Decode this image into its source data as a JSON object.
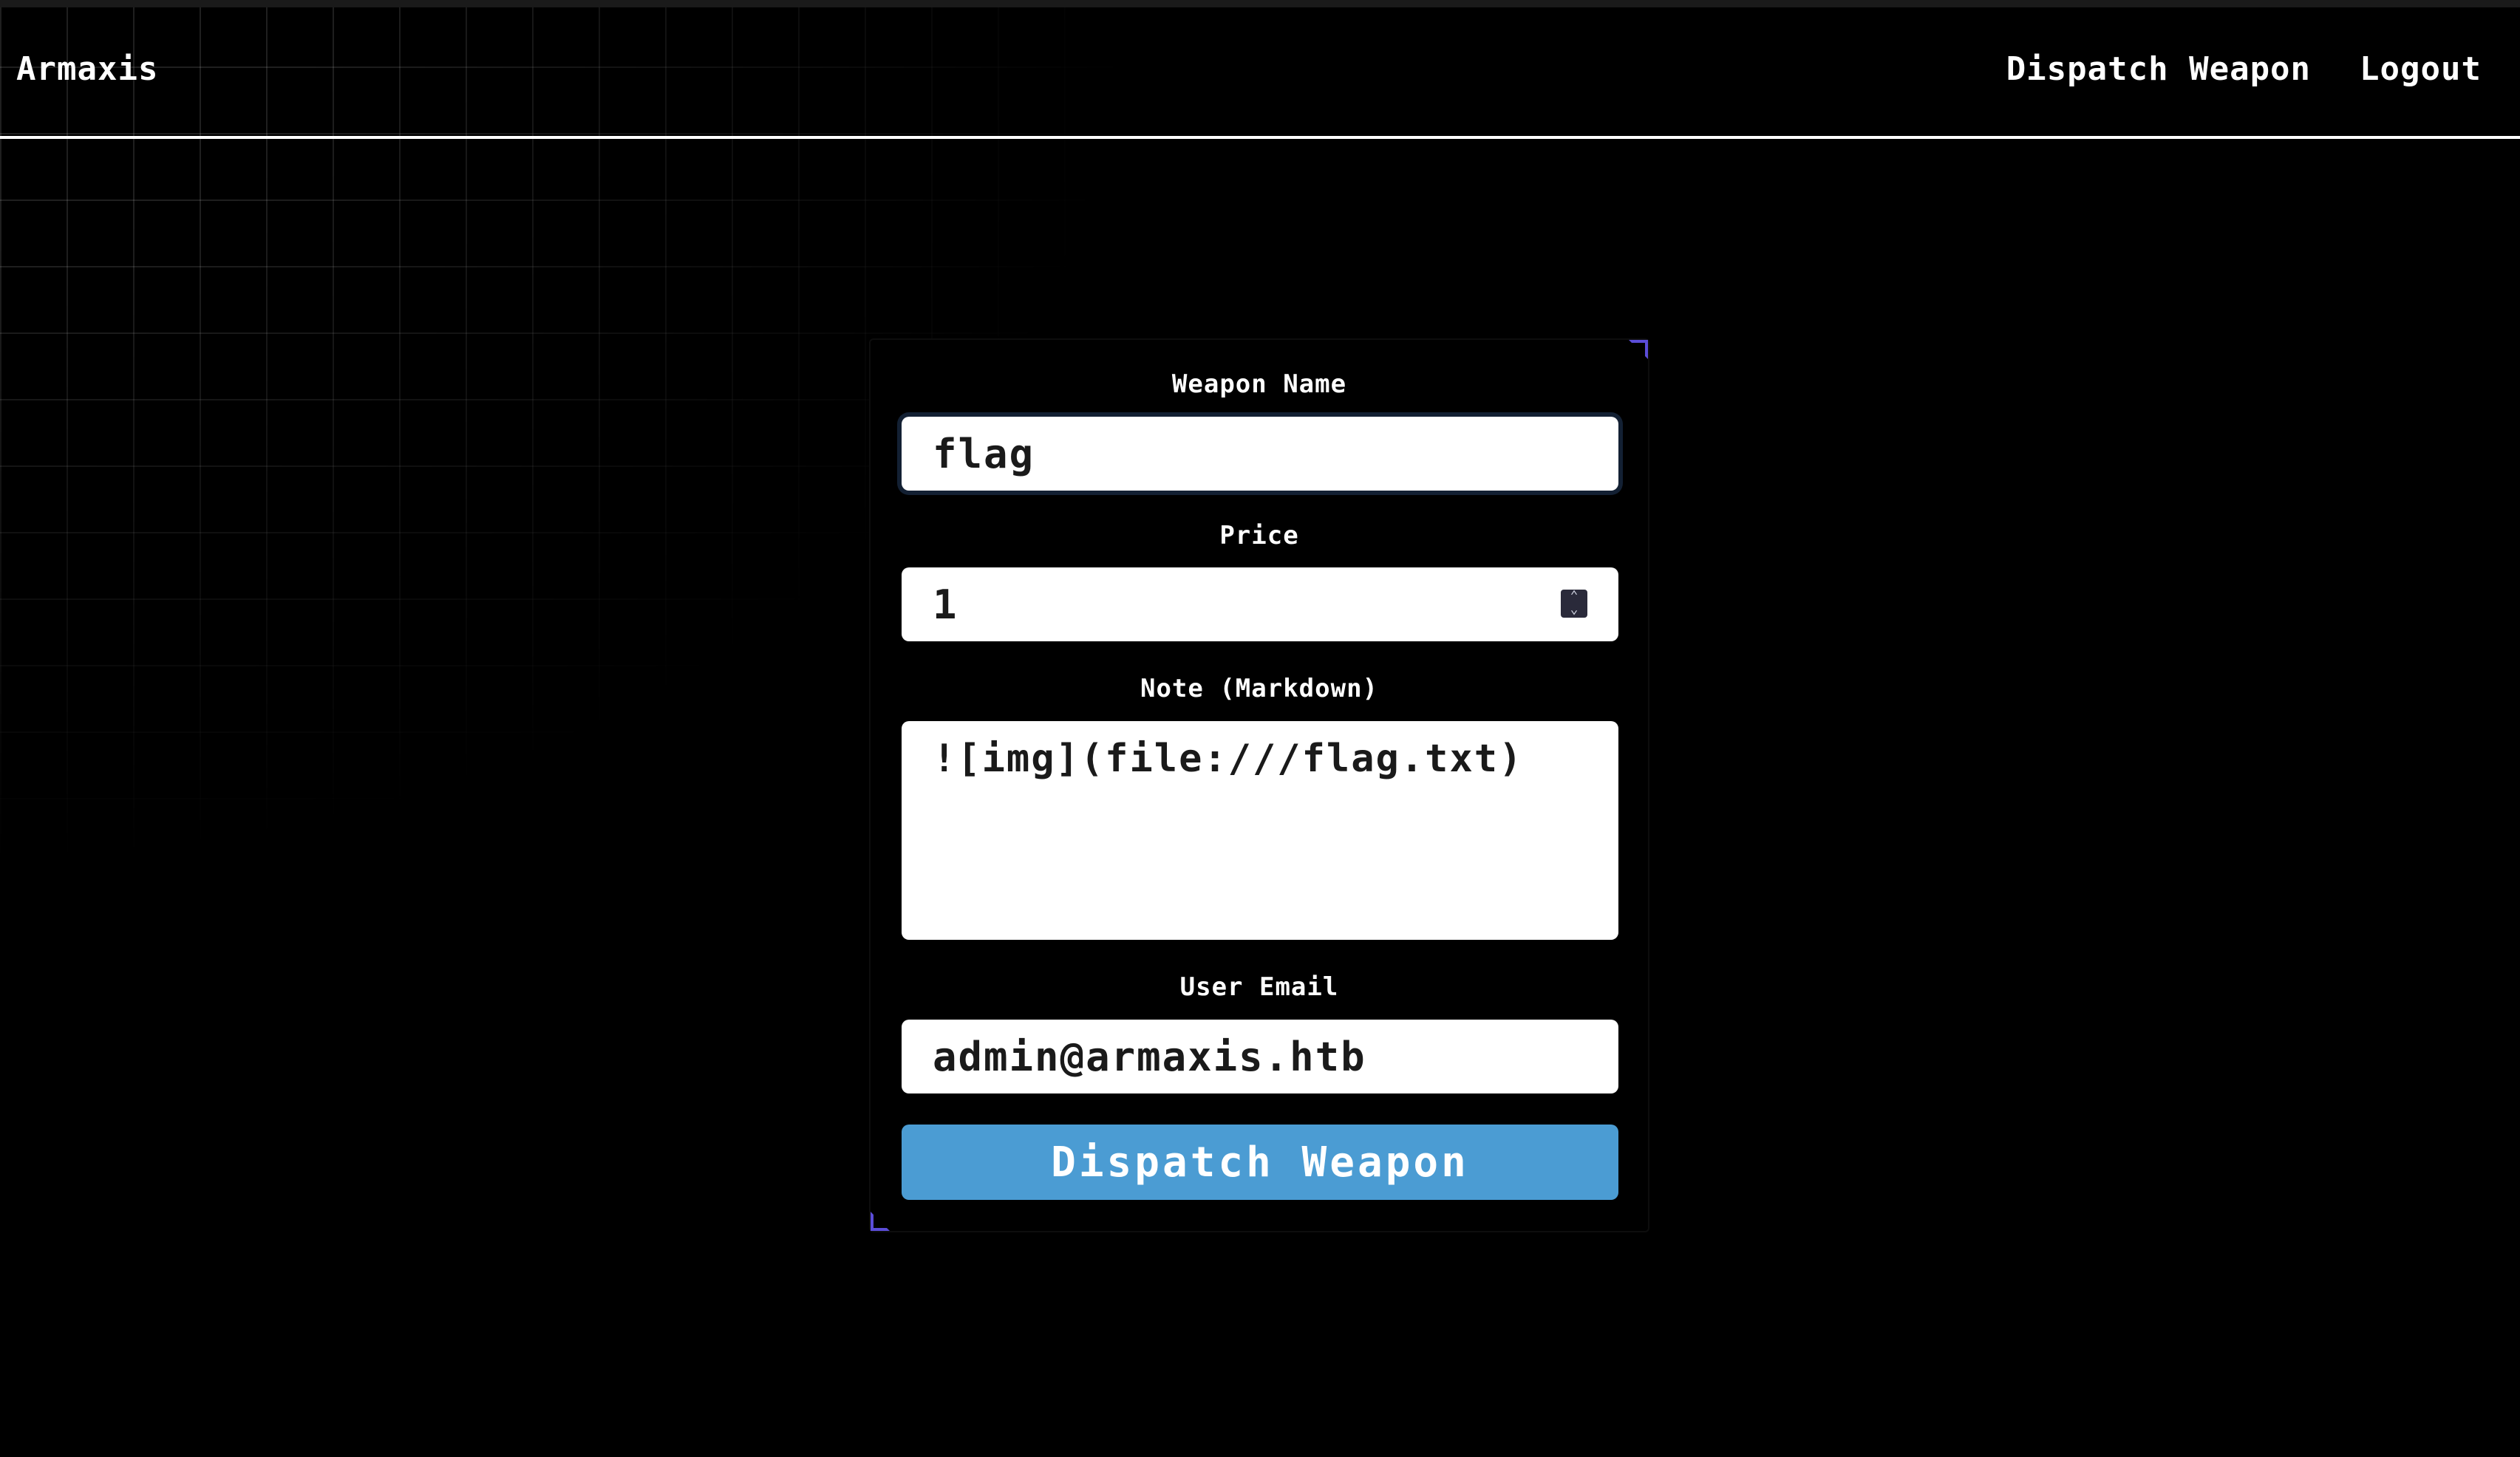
{
  "navbar": {
    "brand": "Armaxis",
    "links": [
      {
        "label": "Dispatch Weapon"
      },
      {
        "label": "Logout"
      }
    ]
  },
  "form": {
    "weapon_name": {
      "label": "Weapon Name",
      "value": "flag"
    },
    "price": {
      "label": "Price",
      "value": "1"
    },
    "note": {
      "label": "Note (Markdown)",
      "value": "![img](file:///flag.txt)"
    },
    "user_email": {
      "label": "User Email",
      "value": "admin@armaxis.htb"
    },
    "submit_label": "Dispatch Weapon"
  },
  "icons": {
    "spinner": "up-down-arrows-icon"
  },
  "colors": {
    "background": "#000000",
    "button": "#4b9cd3",
    "accent_corner": "#5b4dd8"
  }
}
